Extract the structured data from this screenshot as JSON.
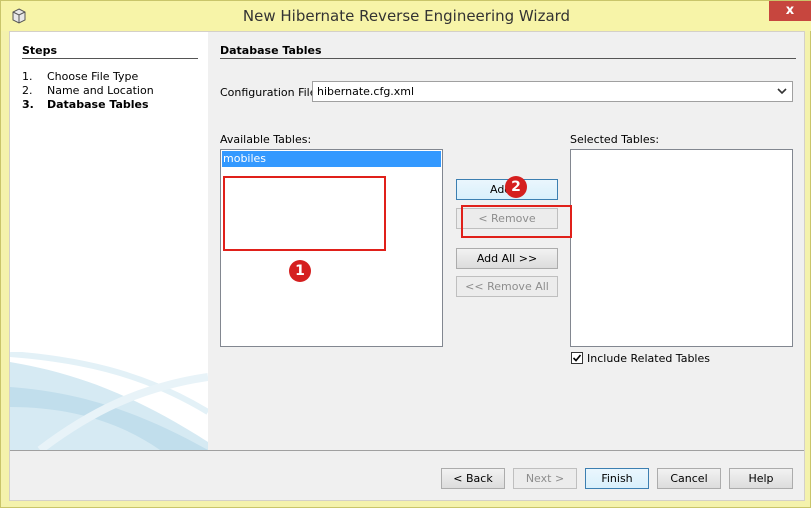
{
  "window": {
    "title": "New Hibernate Reverse Engineering Wizard",
    "close_glyph": "x"
  },
  "steps": {
    "title": "Steps",
    "items": [
      {
        "num": "1.",
        "label": "Choose File Type",
        "active": false
      },
      {
        "num": "2.",
        "label": "Name and Location",
        "active": false
      },
      {
        "num": "3.",
        "label": "Database Tables",
        "active": true
      }
    ]
  },
  "main": {
    "title": "Database Tables",
    "config_label": "Configuration File:",
    "config_value": "hibernate.cfg.xml",
    "available_label": "Available Tables:",
    "available_tables": [
      "mobiles"
    ],
    "selected_label": "Selected Tables:",
    "selected_tables": [],
    "include_related_label": "Include Related Tables",
    "include_related_checked": true
  },
  "transfer_buttons": {
    "add": "Add >",
    "remove": "< Remove",
    "add_all": "Add All >>",
    "remove_all": "<< Remove All"
  },
  "footer": {
    "back": "< Back",
    "next": "Next >",
    "finish": "Finish",
    "cancel": "Cancel",
    "help": "Help"
  },
  "annotations": {
    "badge_1": "1",
    "badge_2": "2",
    "color": "#d51f1f"
  },
  "icons": {
    "app": "app-cube-icon",
    "dropdown": "chevron-down-icon",
    "check": "checkmark-icon"
  }
}
